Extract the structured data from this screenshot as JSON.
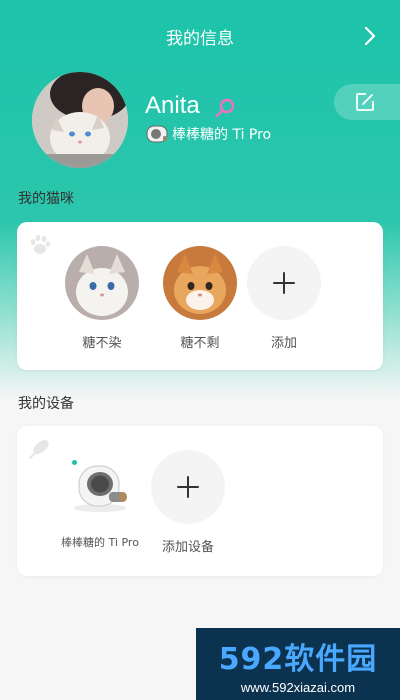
{
  "header": {
    "title": "我的信息"
  },
  "profile": {
    "name": "Anita",
    "device_name": "棒棒糖的 Ti Pro"
  },
  "cats": {
    "section_title": "我的猫咪",
    "items": [
      {
        "label": "糖不染"
      },
      {
        "label": "糖不剩"
      }
    ],
    "add_label": "添加"
  },
  "devices": {
    "section_title": "我的设备",
    "items": [
      {
        "label": "棒棒糖的 Ti Pro"
      }
    ],
    "add_label": "添加设备"
  },
  "watermark": {
    "brand": "592软件园",
    "url": "www.592xiazai.com"
  },
  "colors": {
    "accent": "#1cc3a9",
    "background": "#f6f6f6"
  }
}
